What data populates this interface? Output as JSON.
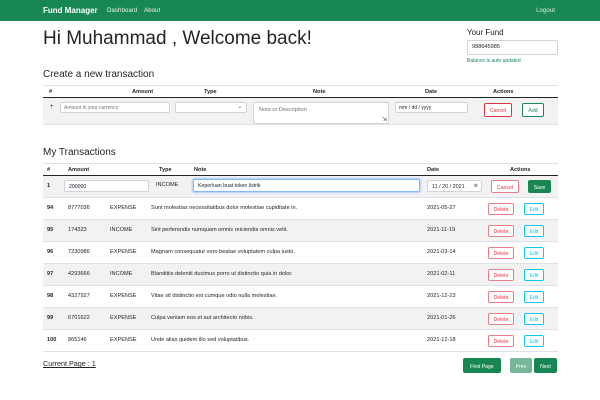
{
  "navbar": {
    "brand": "Fund Manager",
    "dashboard": "Dashboard",
    "about": "About",
    "logout": "Logout"
  },
  "welcome": "Hi Muhammad , Welcome back!",
  "fund": {
    "label": "Your Fund",
    "value": "988645985",
    "help": "Balance is auto updated"
  },
  "create": {
    "title": "Create a new transaction",
    "headers": {
      "num": "#",
      "amount": "Amount",
      "type": "Type",
      "note": "Note",
      "date": "Date",
      "actions": "Actions"
    },
    "row": {
      "plus": "+",
      "amount_placeholder": "Amount in your currency",
      "note_placeholder": "Note or Description",
      "date_placeholder": "mm / dd / yyyy",
      "cancel": "Cancel",
      "add": "Add"
    }
  },
  "transactions": {
    "title": "My Transactions",
    "headers": {
      "num": "#",
      "amount": "Amount",
      "type": "Type",
      "note": "Note",
      "date": "Date",
      "actions": "Actions"
    },
    "editing": {
      "id": "1",
      "amount": "200000",
      "type": "INCOME",
      "note": "Keperluan buat token listrik",
      "date": "11 / 20 / 2021",
      "cancel": "Cancel",
      "save": "Save"
    },
    "rows": [
      {
        "id": "94",
        "amount": "8777036",
        "type": "EXPENSE",
        "note": "Sunt molestias necessitatibus dolor molestiae cupiditate in.",
        "date": "2021-05-27",
        "delete": "Delete",
        "edit": "Edit"
      },
      {
        "id": "95",
        "amount": "174323",
        "type": "INCOME",
        "note": "Sint perferendis numquam omnis reiciendis omnis velit.",
        "date": "2021-11-19",
        "delete": "Delete",
        "edit": "Edit"
      },
      {
        "id": "96",
        "amount": "7230986",
        "type": "EXPENSE",
        "note": "Magnam consequatur vero beatae voluptatem culpa iusto.",
        "date": "2021-03-14",
        "delete": "Delete",
        "edit": "Edit"
      },
      {
        "id": "97",
        "amount": "4293666",
        "type": "INCOME",
        "note": "Blanditiis deleniti ducimus porro ut distinctio quia in dolor.",
        "date": "2021-02-11",
        "delete": "Delete",
        "edit": "Edit"
      },
      {
        "id": "98",
        "amount": "4327927",
        "type": "EXPENSE",
        "note": "Vitae sit distinctio est cumque odio nulla molestiae.",
        "date": "2021-12-23",
        "delete": "Delete",
        "edit": "Edit"
      },
      {
        "id": "99",
        "amount": "6701622",
        "type": "EXPENSE",
        "note": "Culpa veniam eos et aut architecto nobis.",
        "date": "2021-01-26",
        "delete": "Delete",
        "edit": "Edit"
      },
      {
        "id": "100",
        "amount": "865146",
        "type": "EXPENSE",
        "note": "Unde alias quidem illo sed voluptatibus.",
        "date": "2021-12-18",
        "delete": "Delete",
        "edit": "Edit"
      }
    ]
  },
  "pagination": {
    "current_page": "Current Page : 1",
    "first": "First Page",
    "prev": "Prev",
    "next": "Next"
  },
  "colors": {
    "primary": "#198754",
    "danger": "#dc3545",
    "info": "#0dcaf0"
  }
}
